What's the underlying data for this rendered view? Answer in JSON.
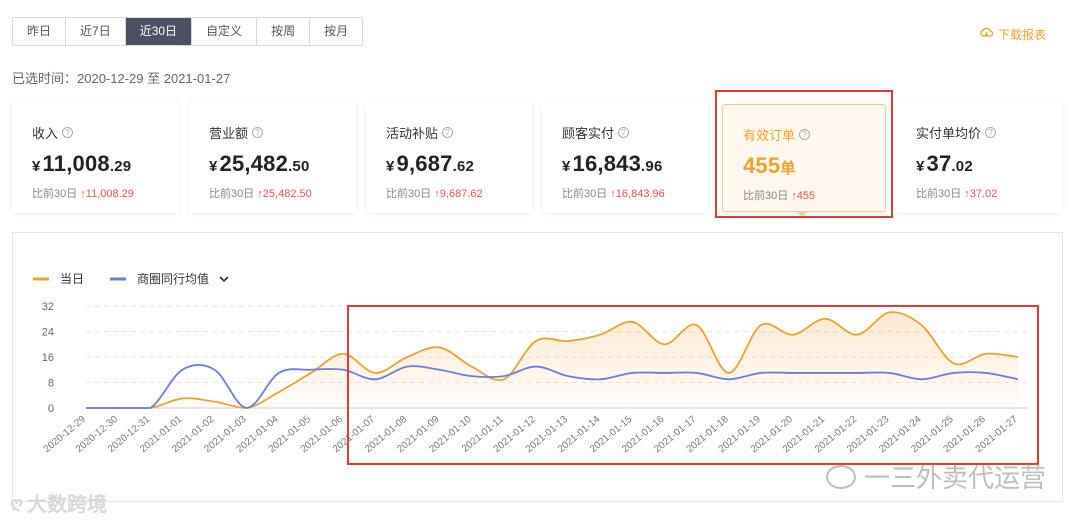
{
  "tabs": [
    "昨日",
    "近7日",
    "近30日",
    "自定义",
    "按周",
    "按月"
  ],
  "active_tab_index": 2,
  "download_label": "下载报表",
  "date_range": "已选时间：2020-12-29 至 2021-01-27",
  "cards": [
    {
      "title": "收入",
      "currency": "¥",
      "int": "11,008",
      "dec": ".29",
      "unit": "",
      "compare_label": "比前30日",
      "compare_value": "11,008.29"
    },
    {
      "title": "营业额",
      "currency": "¥",
      "int": "25,482",
      "dec": ".50",
      "unit": "",
      "compare_label": "比前30日",
      "compare_value": "25,482.50"
    },
    {
      "title": "活动补贴",
      "currency": "¥",
      "int": "9,687",
      "dec": ".62",
      "unit": "",
      "compare_label": "比前30日",
      "compare_value": "9,687.62"
    },
    {
      "title": "顾客实付",
      "currency": "¥",
      "int": "16,843",
      "dec": ".96",
      "unit": "",
      "compare_label": "比前30日",
      "compare_value": "16,843.96"
    },
    {
      "title": "有效订单",
      "currency": "",
      "int": "455",
      "dec": "",
      "unit": "单",
      "compare_label": "比前30日",
      "compare_value": "455"
    },
    {
      "title": "实付单均价",
      "currency": "¥",
      "int": "37",
      "dec": ".02",
      "unit": "",
      "compare_label": "比前30日",
      "compare_value": "37.02"
    }
  ],
  "colors": {
    "accent": "#f0a030",
    "series_line": "#6b7fd7",
    "active_tab": "#4a5262",
    "up": "#e8534b",
    "annotation": "#e53935"
  },
  "watermark_left": "大数跨境",
  "watermark_right": "一三外卖代运营",
  "chart_data": {
    "type": "line",
    "x": [
      "2020-12-29",
      "2020-12-30",
      "2020-12-31",
      "2021-01-01",
      "2021-01-02",
      "2021-01-03",
      "2021-01-04",
      "2021-01-05",
      "2021-01-06",
      "2021-01-07",
      "2021-01-08",
      "2021-01-09",
      "2021-01-10",
      "2021-01-11",
      "2021-01-12",
      "2021-01-13",
      "2021-01-14",
      "2021-01-15",
      "2021-01-16",
      "2021-01-17",
      "2021-01-18",
      "2021-01-19",
      "2021-01-20",
      "2021-01-21",
      "2021-01-22",
      "2021-01-23",
      "2021-01-24",
      "2021-01-25",
      "2021-01-26",
      "2021-01-27"
    ],
    "series": [
      {
        "name": "当日",
        "color": "#f0a030",
        "area": true,
        "values": [
          0,
          0,
          0,
          3,
          2,
          0,
          5,
          11,
          17,
          11,
          16,
          19,
          13,
          9,
          21,
          21,
          23,
          27,
          20,
          26,
          11,
          26,
          23,
          28,
          23,
          30,
          26,
          14,
          17,
          16
        ]
      },
      {
        "name": "商圈同行均值",
        "color": "#6b7fd7",
        "area": false,
        "values": [
          0,
          0,
          0,
          12,
          12,
          0,
          11,
          12,
          12,
          9,
          13,
          12,
          10,
          10,
          13,
          10,
          9,
          11,
          11,
          11,
          9,
          11,
          11,
          11,
          11,
          11,
          9,
          11,
          11,
          9
        ]
      }
    ],
    "yticks": [
      0,
      8,
      16,
      24,
      32
    ],
    "ylim": [
      0,
      32
    ],
    "grid": true,
    "legend": "top-left"
  }
}
